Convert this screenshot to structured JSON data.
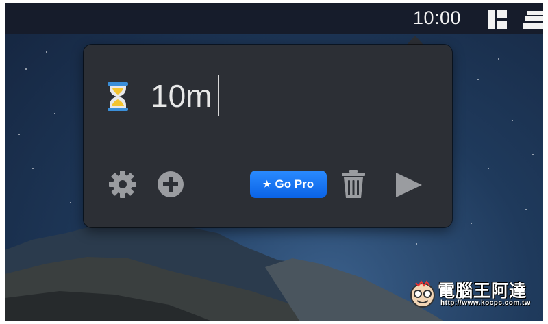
{
  "menubar": {
    "clock": "10:00",
    "icons": [
      "layout-grid-icon",
      "stacked-windows-icon"
    ]
  },
  "popover": {
    "timer_icon": "hourglass-icon",
    "timer_value": "10m",
    "toolbar": {
      "settings_icon": "gear-icon",
      "add_icon": "plus-circle-icon",
      "gopro_label": "Go Pro",
      "gopro_icon": "star-icon",
      "delete_icon": "trash-icon",
      "start_icon": "play-icon"
    },
    "accent": "#1a78f2"
  },
  "watermark": {
    "title": "電腦王阿達",
    "url": "http://www.kocpc.com.tw"
  }
}
